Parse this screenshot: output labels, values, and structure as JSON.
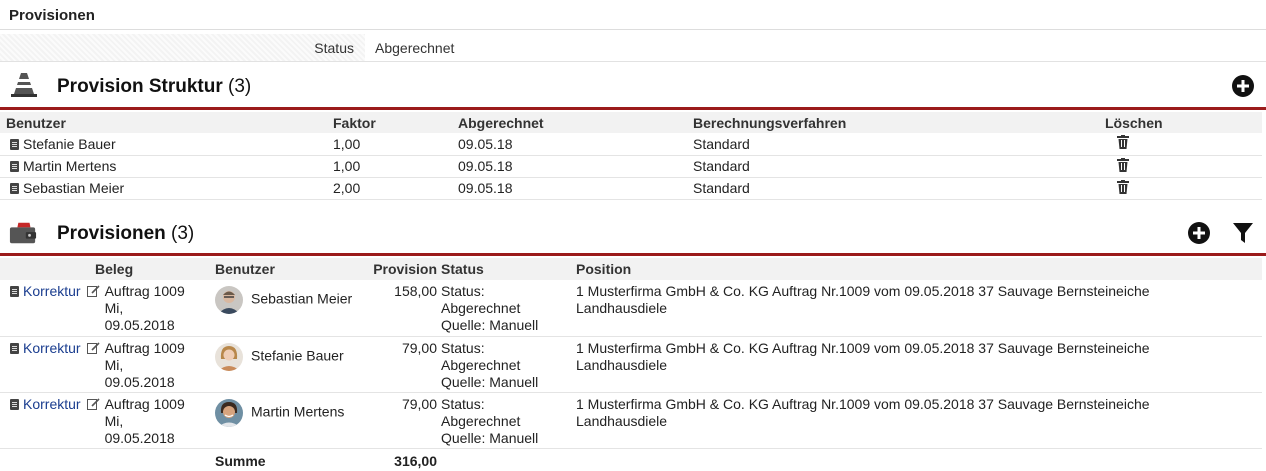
{
  "page": {
    "title": "Provisionen"
  },
  "status": {
    "label": "Status",
    "value": "Abgerechnet"
  },
  "struktur": {
    "title": "Provision Struktur",
    "count": "(3)",
    "headers": {
      "benutzer": "Benutzer",
      "faktor": "Faktor",
      "abgerechnet": "Abgerechnet",
      "verfahren": "Berechnungsverfahren",
      "loeschen": "Löschen"
    },
    "rows": [
      {
        "benutzer": "Stefanie Bauer",
        "faktor": "1,00",
        "abgerechnet": "09.05.18",
        "verfahren": "Standard"
      },
      {
        "benutzer": "Martin Mertens",
        "faktor": "1,00",
        "abgerechnet": "09.05.18",
        "verfahren": "Standard"
      },
      {
        "benutzer": "Sebastian Meier",
        "faktor": "2,00",
        "abgerechnet": "09.05.18",
        "verfahren": "Standard"
      }
    ]
  },
  "provisionen": {
    "title": "Provisionen",
    "count": "(3)",
    "headers": {
      "beleg": "Beleg",
      "benutzer": "Benutzer",
      "provision": "Provision",
      "status": "Status",
      "position": "Position"
    },
    "rows": [
      {
        "korrektur": "Korrektur",
        "auftrag": "Auftrag 1009",
        "tag": "Mi,",
        "datum": "09.05.2018",
        "benutzer": "Sebastian Meier",
        "provision": "158,00",
        "status1": "Status:",
        "status2": "Abgerechnet",
        "quelle": "Quelle: Manuell",
        "position1": "1 Musterfirma GmbH & Co. KG Auftrag Nr.1009 vom 09.05.2018 37 Sauvage Bernsteineiche",
        "position2": "Landhausdiele"
      },
      {
        "korrektur": "Korrektur",
        "auftrag": "Auftrag 1009",
        "tag": "Mi,",
        "datum": "09.05.2018",
        "benutzer": "Stefanie Bauer",
        "provision": "79,00",
        "status1": "Status:",
        "status2": "Abgerechnet",
        "quelle": "Quelle: Manuell",
        "position1": "1 Musterfirma GmbH & Co. KG Auftrag Nr.1009 vom 09.05.2018 37 Sauvage Bernsteineiche",
        "position2": "Landhausdiele"
      },
      {
        "korrektur": "Korrektur",
        "auftrag": "Auftrag 1009",
        "tag": "Mi,",
        "datum": "09.05.2018",
        "benutzer": "Martin Mertens",
        "provision": "79,00",
        "status1": "Status:",
        "status2": "Abgerechnet",
        "quelle": "Quelle: Manuell",
        "position1": "1 Musterfirma GmbH & Co. KG Auftrag Nr.1009 vom 09.05.2018 37 Sauvage Bernsteineiche",
        "position2": "Landhausdiele"
      }
    ],
    "summe_label": "Summe",
    "summe_value": "316,00"
  },
  "icons": {
    "struktur_section": "traffic-cone-icon",
    "provisionen_section": "wallet-icon",
    "add": "plus-circle-icon",
    "filter": "filter-icon",
    "delete": "trash-icon",
    "doc": "document-icon",
    "edit": "edit-icon"
  },
  "colors": {
    "accent_rule": "#9b1b1b",
    "link": "#1a3d8f"
  }
}
